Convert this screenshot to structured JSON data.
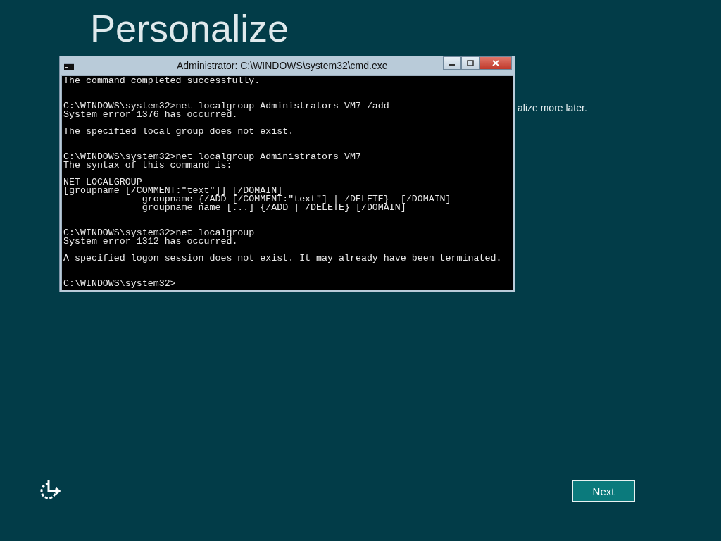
{
  "page": {
    "heading": "Personalize",
    "subtitle_visible": "alize more later."
  },
  "console_window": {
    "title": "Administrator: C:\\WINDOWS\\system32\\cmd.exe",
    "blocks": [
      {
        "kind": "message",
        "lines": [
          "The command completed successfully."
        ]
      },
      {
        "kind": "command",
        "lines": [
          "C:\\WINDOWS\\system32>net localgroup Administrators VM7 /add",
          "System error 1376 has occurred."
        ]
      },
      {
        "kind": "message",
        "lines": [
          "The specified local group does not exist."
        ]
      },
      {
        "kind": "command",
        "lines": [
          "C:\\WINDOWS\\system32>net localgroup Administrators VM7",
          "The syntax of this command is:"
        ]
      },
      {
        "kind": "message",
        "lines": [
          "NET LOCALGROUP",
          "[groupname [/COMMENT:\"text\"]] [/DOMAIN]",
          "              groupname {/ADD [/COMMENT:\"text\"] | /DELETE}  [/DOMAIN]",
          "              groupname name [...] {/ADD | /DELETE} [/DOMAIN]"
        ]
      },
      {
        "kind": "command",
        "lines": [
          "C:\\WINDOWS\\system32>net localgroup",
          "System error 1312 has occurred."
        ]
      },
      {
        "kind": "message",
        "lines": [
          "A specified logon session does not exist. It may already have been terminated."
        ]
      },
      {
        "kind": "command",
        "lines": [
          "C:\\WINDOWS\\system32>"
        ]
      }
    ]
  },
  "footer": {
    "next_button": "Next"
  }
}
